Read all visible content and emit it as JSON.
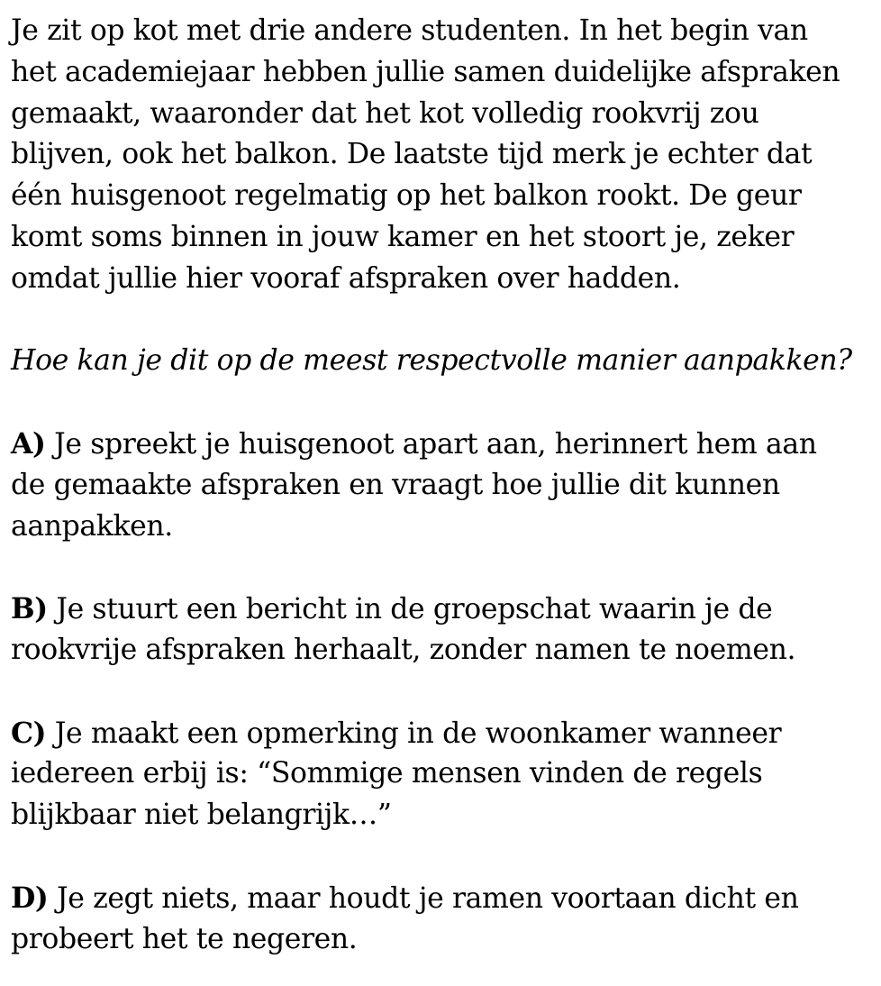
{
  "scenario": {
    "lines": [
      "Je zit op kot met drie andere studenten. In het begin van",
      "het academiejaar hebben jullie samen duidelijke afspraken",
      "gemaakt, waaronder dat het kot volledig rookvrij zou",
      "blijven, ook het balkon. De laatste tijd merk je echter dat",
      "één huisgenoot regelmatig op het balkon rookt. De geur",
      "komt soms binnen in jouw kamer en het stoort je, zeker",
      "omdat jullie hier vooraf afspraken over hadden."
    ]
  },
  "question": "Hoe kan je dit op de meest respectvolle manier aanpakken?",
  "options": [
    {
      "letter": "A)",
      "lines": [
        " Je spreekt je huisgenoot apart aan, herinnert hem aan",
        "de gemaakte afspraken en vraagt hoe jullie dit kunnen",
        "aanpakken."
      ]
    },
    {
      "letter": "B)",
      "lines": [
        " Je stuurt een bericht in de groepschat waarin je de",
        "rookvrije afspraken herhaalt, zonder namen te noemen."
      ]
    },
    {
      "letter": "C)",
      "lines": [
        " Je maakt een opmerking in de woonkamer wanneer",
        "iedereen erbij is: “Sommige mensen vinden de regels",
        "blijkbaar niet belangrijk…”"
      ]
    },
    {
      "letter": "D)",
      "lines": [
        " Je zegt niets, maar houdt je ramen voortaan dicht en",
        "probeert het te negeren."
      ]
    }
  ]
}
